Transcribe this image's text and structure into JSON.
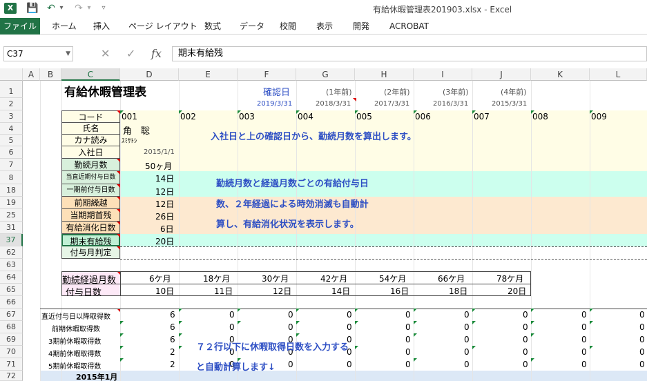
{
  "window": {
    "title": "有給休暇管理表201903.xlsx - Excel"
  },
  "quick_access": {
    "excel_icon": "X",
    "save": "💾",
    "undo": "↶",
    "undo_dd": "▾",
    "redo": "↷",
    "redo_dd": "▾",
    "more": "▿"
  },
  "ribbon": {
    "file": "ファイル",
    "tabs": [
      "ホーム",
      "挿入",
      "ページ レイアウト",
      "数式",
      "データ",
      "校閲",
      "表示",
      "開発",
      "ACROBAT"
    ]
  },
  "formula_bar": {
    "cell_ref": "C37",
    "cancel": "✕",
    "enter": "✓",
    "fx": "fx",
    "value": "期末有給残"
  },
  "columns": [
    "A",
    "B",
    "C",
    "D",
    "E",
    "F",
    "G",
    "H",
    "I",
    "J",
    "K",
    "L"
  ],
  "rows": [
    "1",
    "2",
    "3",
    "4",
    "5",
    "6",
    "7",
    "8",
    "18",
    "19",
    "25",
    "31",
    "37",
    "62",
    "63",
    "64",
    "65",
    "66",
    "67",
    "68",
    "69",
    "70",
    "71",
    "72"
  ],
  "sheet": {
    "title": "有給休暇管理表",
    "confirm_label": "確認日",
    "year_labels": [
      "(1年前)",
      "(2年前)",
      "(3年前)",
      "(4年前)"
    ],
    "dates": [
      "2019/3/31",
      "2018/3/31",
      "2017/3/31",
      "2016/3/31",
      "2015/3/31"
    ],
    "labels": [
      "コード",
      "氏名",
      "カナ読み",
      "入社日",
      "勤続月数",
      "当直近期付与日数",
      "一期前付与日数",
      "前期繰越",
      "当期期首残",
      "有給消化日数",
      "期末有給残",
      "付与月判定"
    ],
    "codes": [
      "001",
      "002",
      "003",
      "004",
      "005",
      "006",
      "007",
      "008",
      "009"
    ],
    "name": "角　聡",
    "kana": "ｽﾐｻﾄｼ",
    "hire_date": "2015/1/1",
    "values": [
      "50ヶ月",
      "14日",
      "12日",
      "12日",
      "26日",
      "6日",
      "20日"
    ],
    "grant_table": {
      "header1": "勤続経過月数",
      "header2": "付与日数",
      "months": [
        "6ケ月",
        "18ケ月",
        "30ケ月",
        "42ケ月",
        "54ケ月",
        "66ケ月",
        "78ケ月"
      ],
      "days": [
        "10日",
        "11日",
        "12日",
        "14日",
        "16日",
        "18日",
        "20日"
      ]
    },
    "taken_labels": [
      "直近付与日以降取得数",
      "前期休暇取得数",
      "3期前休暇取得数",
      "4期前休暇取得数",
      "5期前休暇取得数"
    ],
    "taken_d": [
      "6",
      "6",
      "6",
      "2",
      "2"
    ],
    "zero": "0",
    "month_label": "2015年1月",
    "notes": [
      "入社日と上の確認日から、勤続月数を算出します。",
      "勤続月数と経過月数ごとの有給付与日",
      "数、２年経過による時効消滅も自動計",
      "算し、有給消化状況を表示します。",
      "７２行以下に休暇取得日数を入力する",
      "と自動計算します↓"
    ]
  },
  "colors": {
    "excel_green": "#217346",
    "yellow_band": "#fffde6",
    "green_band": "#ccffee",
    "orange_band": "#fde9d0",
    "pink": "#fde9f7",
    "blue_band": "#dce8f6",
    "note_text": "#2e4fc4",
    "date_text": "#2e4fc4"
  }
}
